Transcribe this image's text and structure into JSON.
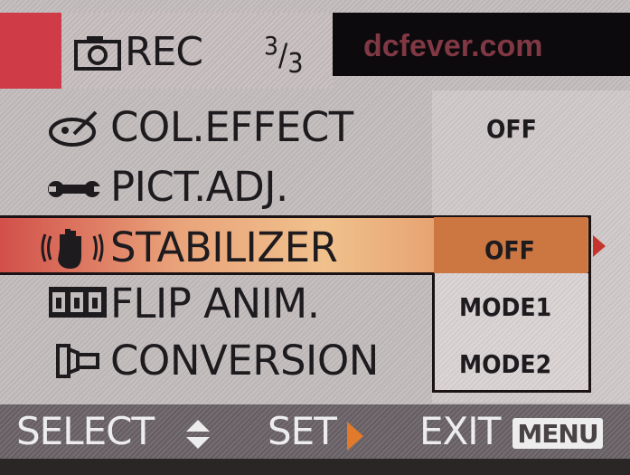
{
  "header": {
    "mode_label": "REC",
    "page_current": "3",
    "page_total": "3",
    "watermark": "dcfever.com"
  },
  "menu": {
    "items": [
      {
        "label": "COL.EFFECT",
        "icon": "color-effect-icon",
        "value": "OFF"
      },
      {
        "label": "PICT.ADJ.",
        "icon": "wrench-icon",
        "value": ""
      },
      {
        "label": "STABILIZER",
        "icon": "hand-shake-icon",
        "value": "OFF",
        "selected": true
      },
      {
        "label": "FLIP ANIM.",
        "icon": "flip-anim-icon",
        "value": ""
      },
      {
        "label": "CONVERSION",
        "icon": "conversion-lens-icon",
        "value": ""
      }
    ],
    "dropdown_options": [
      "MODE1",
      "MODE2"
    ]
  },
  "footer": {
    "select_label": "SELECT",
    "set_label": "SET",
    "exit_label": "EXIT",
    "menu_label": "MENU"
  },
  "colors": {
    "highlight": "#f0c18c",
    "accent_red": "#cf3c48",
    "value_box": "#cc7742"
  }
}
